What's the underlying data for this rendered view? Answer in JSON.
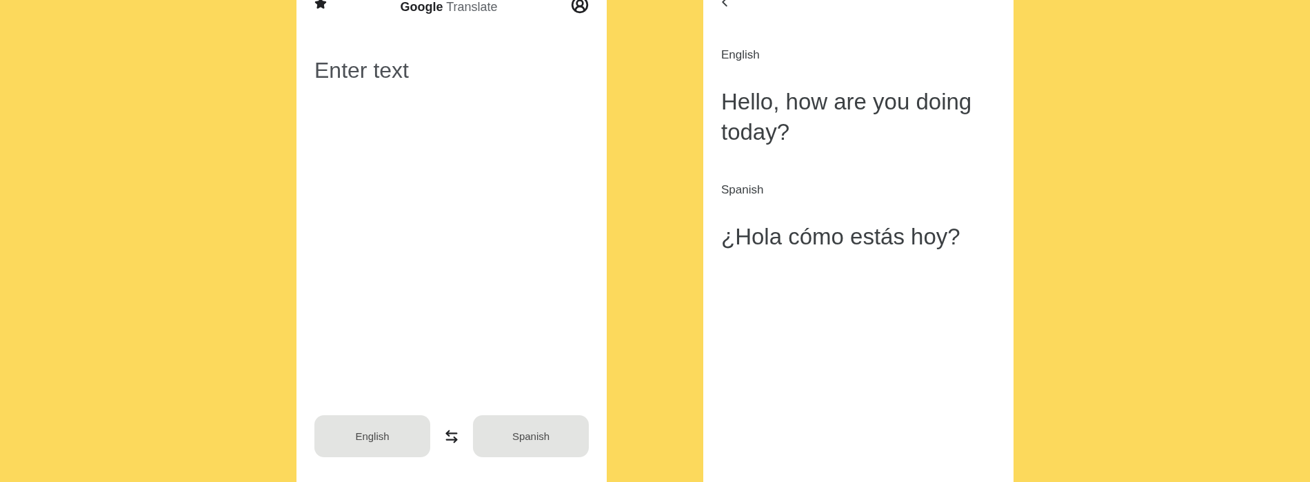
{
  "left_screen": {
    "header": {
      "title_brand": "Google",
      "title_product": "Translate"
    },
    "input": {
      "placeholder": "Enter text"
    },
    "languages": [
      {
        "label": "English"
      },
      {
        "label": "Spanish"
      }
    ]
  },
  "right_screen": {
    "entries": [
      {
        "language": "English",
        "text": "Hello, how are you doing today?"
      },
      {
        "language": "Spanish",
        "text": "¿Hola cómo estás hoy?"
      }
    ]
  }
}
